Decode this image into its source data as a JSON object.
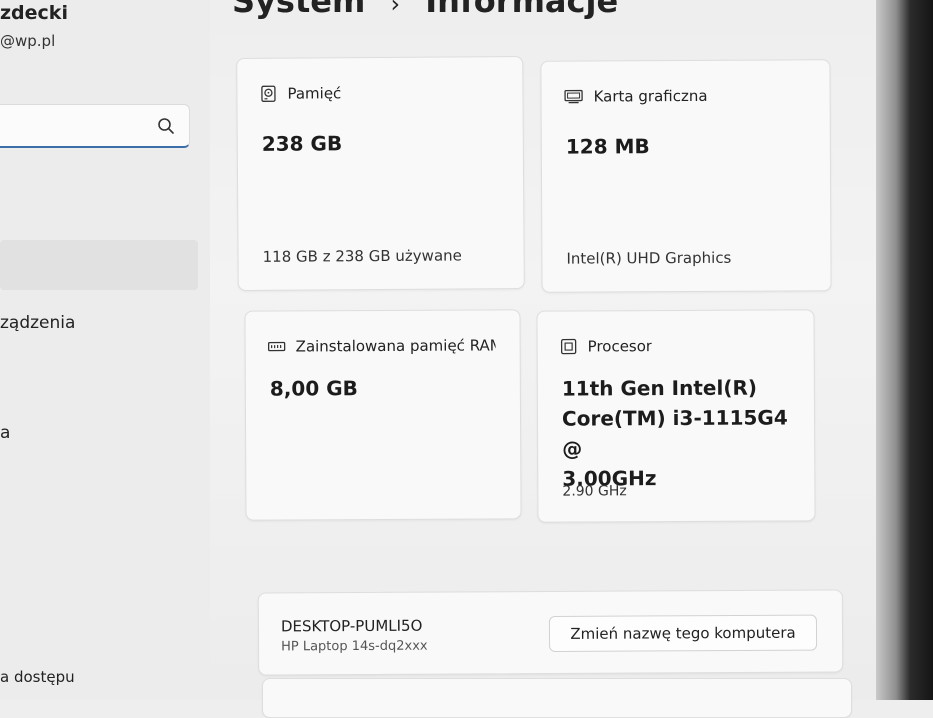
{
  "account": {
    "name": "zdecki",
    "email": "@wp.pl"
  },
  "search": {
    "value": "",
    "placeholder": ""
  },
  "sidebar": {
    "items": [
      {
        "label": "ządzenia"
      },
      {
        "label": "a"
      },
      {
        "label": "a dostępu"
      }
    ]
  },
  "header": {
    "title_section": "System",
    "separator": "›",
    "title_page": "Informacje"
  },
  "cards": {
    "storage": {
      "label": "Pamięć",
      "value": "238 GB",
      "sub": "118 GB z 238 GB używane"
    },
    "gpu": {
      "label": "Karta graficzna",
      "value": "128 MB",
      "sub": "Intel(R) UHD Graphics"
    },
    "ram": {
      "label": "Zainstalowana pamięć RAM",
      "value": "8,00 GB"
    },
    "cpu": {
      "label": "Procesor",
      "value_line1": "11th Gen Intel(R)",
      "value_line2": "Core(TM) i3-1115G4 @",
      "value_line3": "3.00GHz",
      "sub": "2.90 GHz"
    }
  },
  "device": {
    "name": "DESKTOP-PUMLI5O",
    "model": "HP Laptop 14s-dq2xxx",
    "rename_label": "Zmień nazwę tego komputera"
  },
  "colors": {
    "accent": "#3a6ea8",
    "card_bg": "#f9f9f9",
    "page_bg": "#eeeeee"
  }
}
